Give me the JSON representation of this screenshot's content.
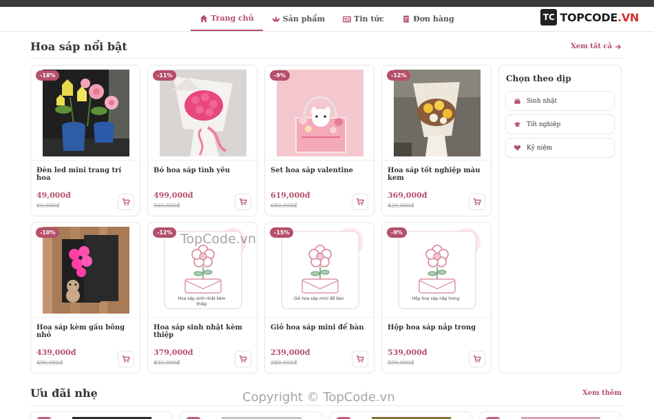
{
  "nav": {
    "items": [
      {
        "label": "Trang chủ",
        "icon": "home-icon",
        "active": true
      },
      {
        "label": "Sản phẩm",
        "icon": "lotus-icon",
        "active": false
      },
      {
        "label": "Tin tức",
        "icon": "newspaper-icon",
        "active": false
      },
      {
        "label": "Đơn hàng",
        "icon": "receipt-icon",
        "active": false
      }
    ]
  },
  "logo": {
    "mark": "TC",
    "text_main": "TOPCODE",
    "text_accent": ".VN"
  },
  "featured": {
    "title": "Hoa sáp nổi bật",
    "link": "Xem tất cả",
    "products": [
      {
        "badge": "-18%",
        "name": "Đèn led mini trang trí hoa",
        "price": "49,000đ",
        "old_price": "60,000đ",
        "image": "photo-tulip-lamp"
      },
      {
        "badge": "-11%",
        "name": "Bó hoa sáp tình yêu",
        "price": "499,000đ",
        "old_price": "560,000đ",
        "image": "photo-pink-bouquet"
      },
      {
        "badge": "-9%",
        "name": "Set hoa sáp valentine",
        "price": "619,000đ",
        "old_price": "680,000đ",
        "image": "photo-valentine-box"
      },
      {
        "badge": "-12%",
        "name": "Hoa sáp tốt nghiệp màu kem",
        "price": "369,000đ",
        "old_price": "420,000đ",
        "image": "photo-graduation-bouquet"
      },
      {
        "badge": "-10%",
        "name": "Hoa sáp kèm gấu bông nhỏ",
        "price": "439,000đ",
        "old_price": "490,000đ",
        "image": "photo-bear-box"
      },
      {
        "badge": "-12%",
        "name": "Hoa sáp sinh nhật kèm thiệp",
        "price": "379,000đ",
        "old_price": "430,000đ",
        "image": "placeholder-flower",
        "placeholder_text": "Hoa sáp sinh nhật kèm thiệp"
      },
      {
        "badge": "-15%",
        "name": "Giỏ hoa sáp mini để bàn",
        "price": "239,000đ",
        "old_price": "280,000đ",
        "image": "placeholder-flower",
        "placeholder_text": "Giỏ hoa sáp mini để bàn"
      },
      {
        "badge": "-9%",
        "name": "Hộp hoa sáp nắp trong",
        "price": "539,000đ",
        "old_price": "590,000đ",
        "image": "placeholder-flower",
        "placeholder_text": "Hộp hoa sáp nắp trong"
      }
    ]
  },
  "sidebar": {
    "title": "Chọn theo dịp",
    "occasions": [
      {
        "label": "Sinh nhật",
        "icon": "cake-icon"
      },
      {
        "label": "Tốt nghiệp",
        "icon": "graduation-cap-icon"
      },
      {
        "label": "Kỷ niệm",
        "icon": "heart-icon"
      }
    ]
  },
  "deals": {
    "title": "Ưu đãi nhẹ",
    "link": "Xem thêm"
  },
  "watermarks": {
    "center": "TopCode.vn",
    "copyright": "Copyright © TopCode.vn"
  },
  "colors": {
    "accent": "#b5506a",
    "border": "#e6e6e6",
    "topbar": "#3a3a3a"
  }
}
